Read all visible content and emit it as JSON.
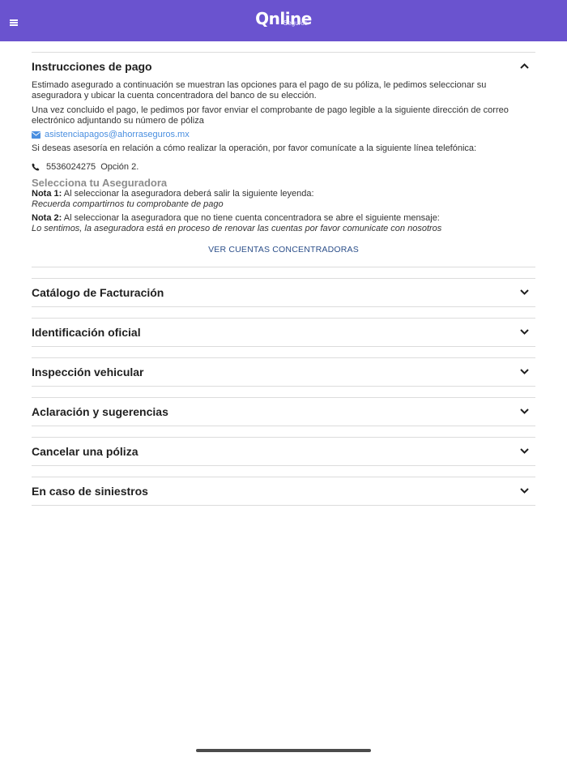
{
  "header": {
    "logo_text": "Qnline",
    "logo_sub": "Seguros",
    "menu_icon": "hamburger-icon",
    "bg_color": "#6a53cf"
  },
  "payment": {
    "title": "Instrucciones de pago",
    "intro": "Estimado asegurado a continuación se muestran las opciones para el pago de su póliza, le pedimos seleccionar su aseguradora y ubicar la cuenta concentradora del banco de su elección.",
    "after_payment": "Una vez concluido el pago, le pedimos por favor enviar el comprobante de pago legible a la siguiente dirección de correo electrónico adjuntando su número de póliza",
    "email": "asistenciapagos@ahorraseguros.mx",
    "advice": "Si deseas asesoría en relación a cómo realizar la operación, por favor comunícate a la siguiente línea telefónica:",
    "phone": "5536024275",
    "option": "Opción 2.",
    "select_title": "Selecciona tu Aseguradora",
    "nota1_label": "Nota 1:",
    "nota1_text": " Al seleccionar la aseguradora deberá salir la siguiente leyenda:",
    "nota1_italic": "Recuerda compartirnos tu comprobante de pago",
    "nota2_label": "Nota 2:",
    "nota2_text": " Al seleccionar la aseguradora que no tiene cuenta concentradora se abre el siguiente mensaje:",
    "nota2_italic": "Lo sentimos, la aseguradora está en proceso de renovar las cuentas por favor comunicate con nosotros",
    "button": "VER CUENTAS CONCENTRADORAS",
    "email_color": "#4a8fe0"
  },
  "sections": [
    {
      "title": "Catálogo de Facturación"
    },
    {
      "title": "Identificación oficial"
    },
    {
      "title": "Inspección vehicular"
    },
    {
      "title": "Aclaración y sugerencias"
    },
    {
      "title": "Cancelar una póliza"
    },
    {
      "title": "En caso de siniestros"
    }
  ]
}
